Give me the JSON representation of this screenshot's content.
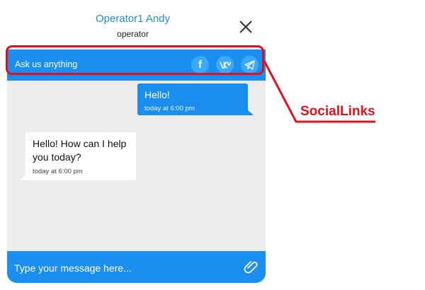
{
  "header": {
    "operator_name": "Operator1 Andy",
    "operator_role": "operator",
    "close_icon": "close-icon"
  },
  "subbar": {
    "prompt": "Ask us anything",
    "social_links": [
      {
        "name": "facebook",
        "icon": "facebook-icon",
        "glyph": "f"
      },
      {
        "name": "vk",
        "icon": "vk-icon"
      },
      {
        "name": "telegram",
        "icon": "telegram-icon"
      }
    ]
  },
  "messages": [
    {
      "direction": "outgoing",
      "text": "Hello!",
      "time": "today at 6:00 pm"
    },
    {
      "direction": "incoming",
      "text": "Hello! How can I help you today?",
      "time": "today at 6:00 pm"
    }
  ],
  "composer": {
    "placeholder": "Type your message here...",
    "attach_icon": "paperclip-icon"
  },
  "annotation": {
    "label": "SocialLinks",
    "color": "#e0101e"
  },
  "colors": {
    "accent": "#1b8ff0",
    "operator_name": "#1a8fe3",
    "background": "#ececec"
  }
}
